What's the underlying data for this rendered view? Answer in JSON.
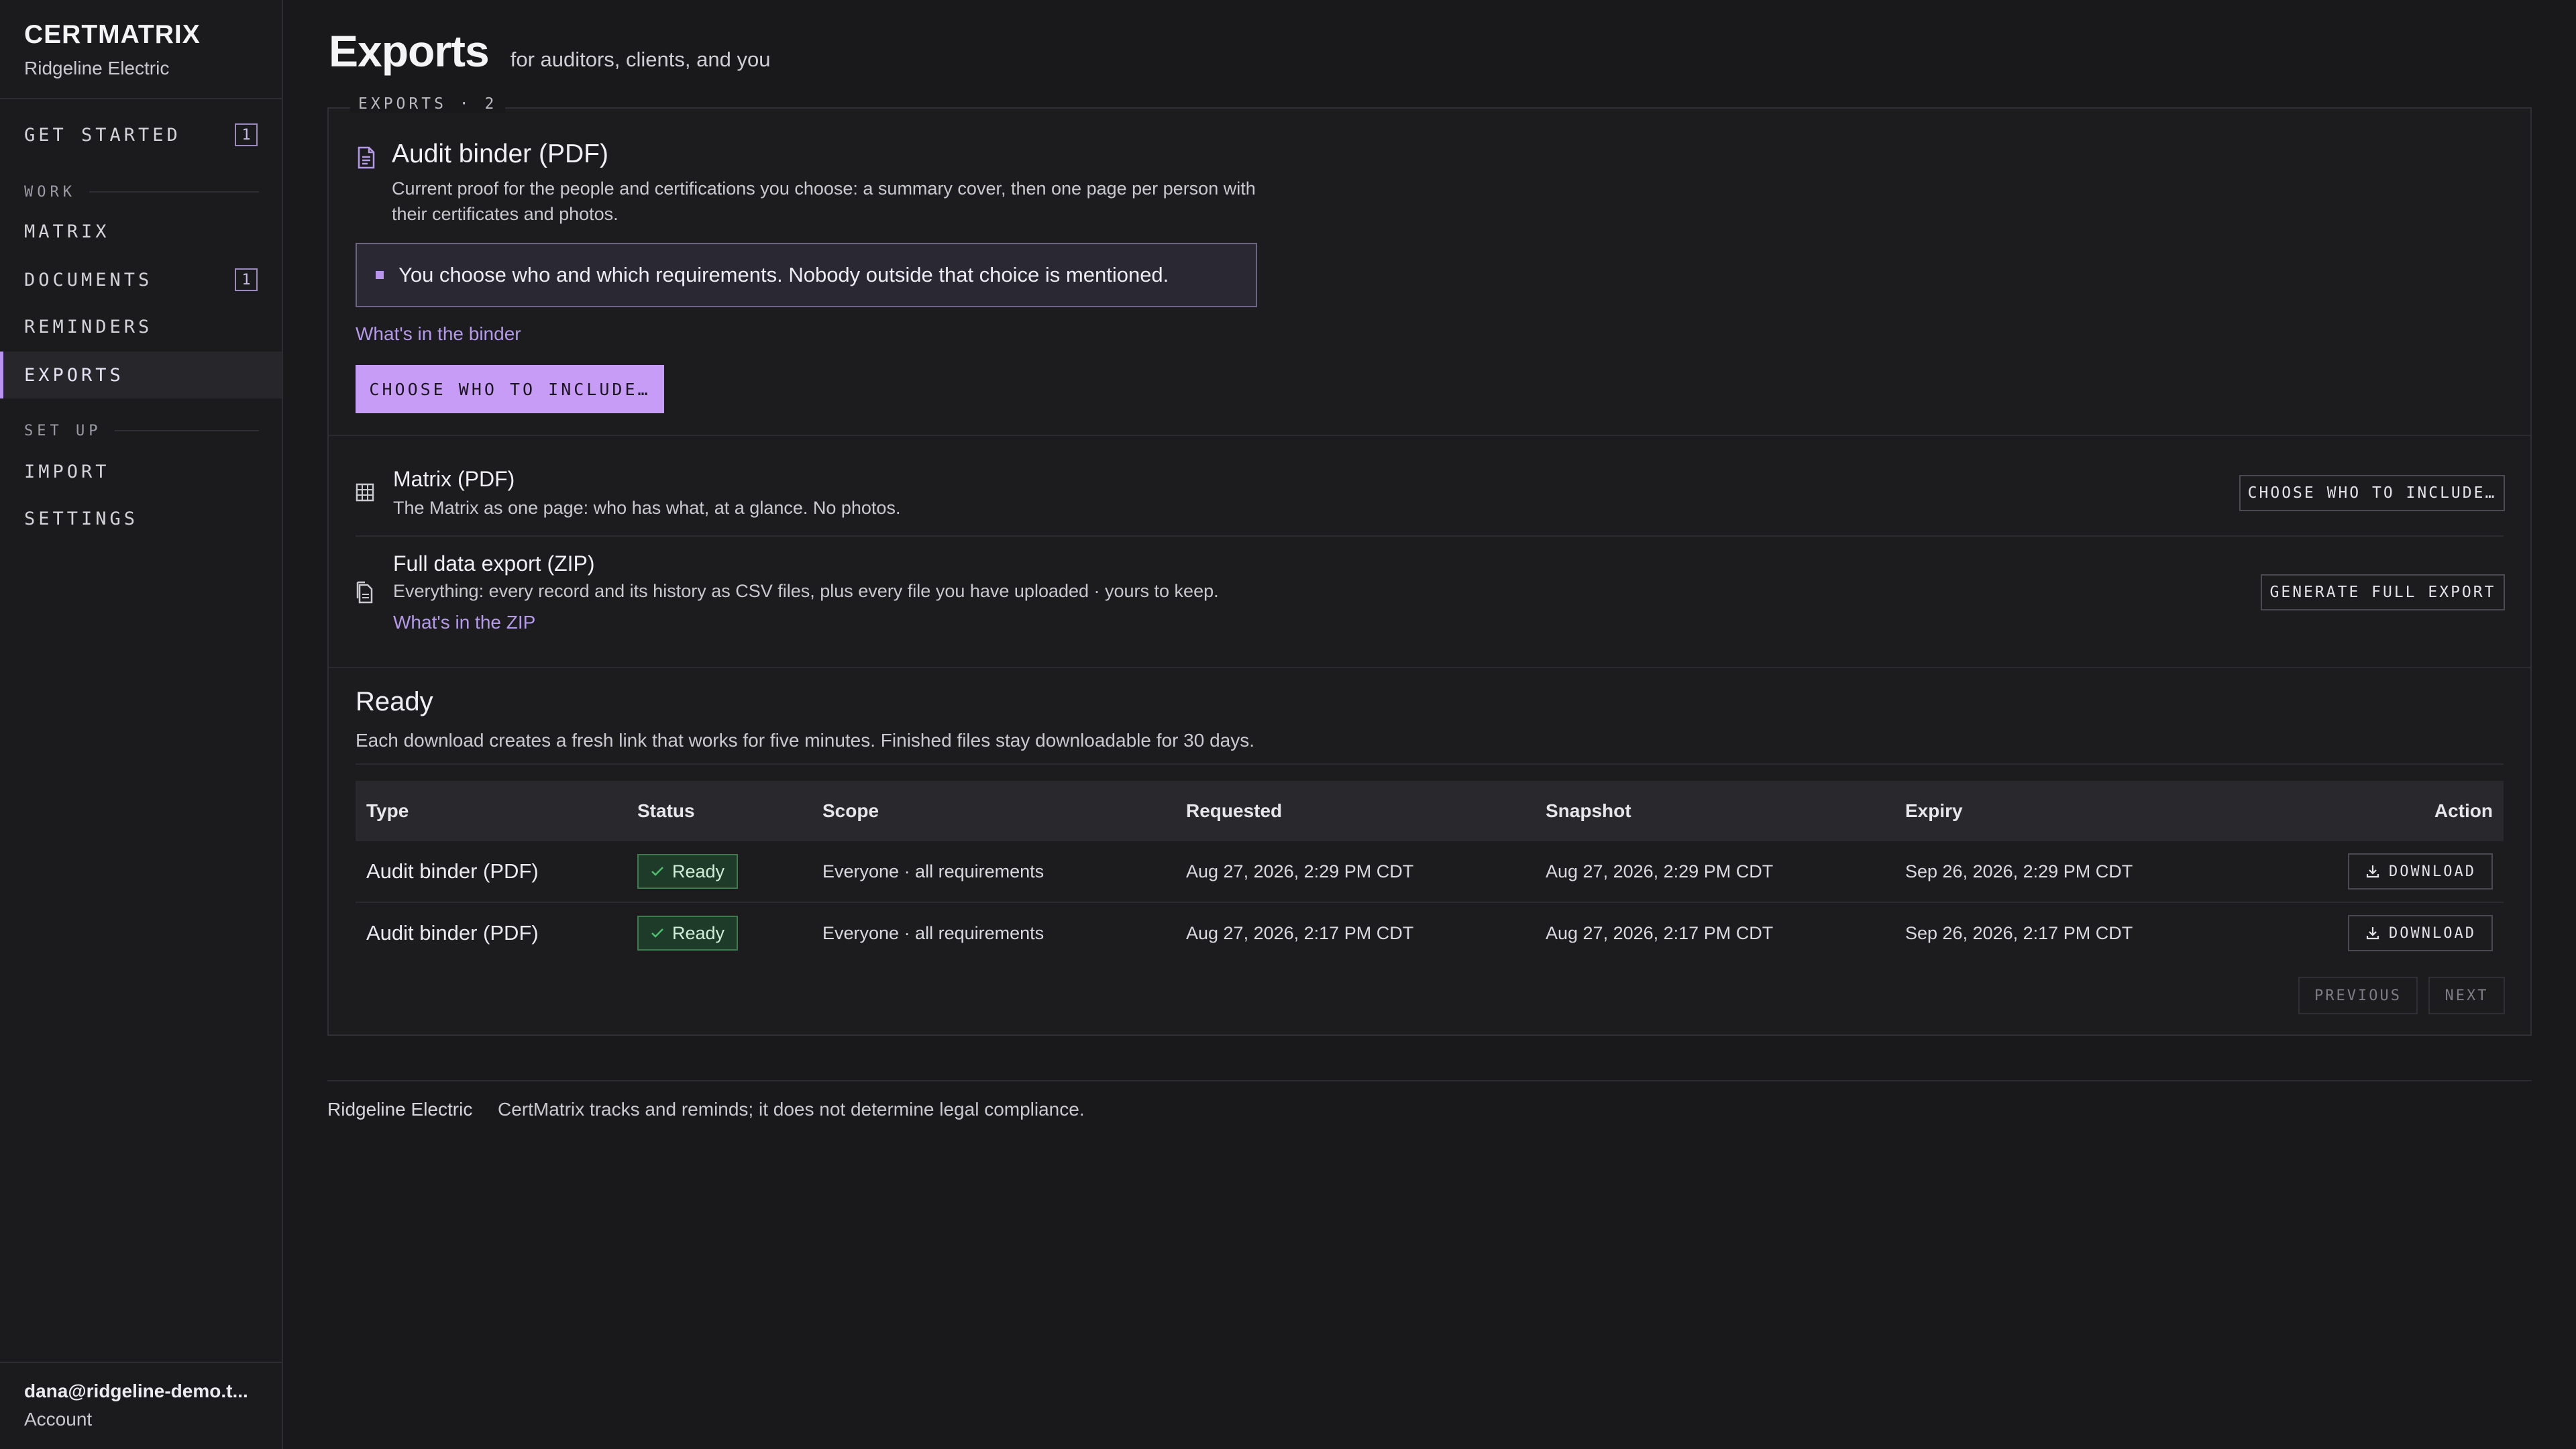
{
  "brand": {
    "name": "CERTMATRIX",
    "org": "Ridgeline Electric"
  },
  "nav": {
    "get_started": {
      "label": "GET STARTED",
      "badge": "1"
    },
    "section_work": "WORK",
    "matrix": "MATRIX",
    "documents": {
      "label": "DOCUMENTS",
      "badge": "1"
    },
    "reminders": "REMINDERS",
    "exports": "EXPORTS",
    "section_setup": "SET UP",
    "import": "IMPORT",
    "settings": "SETTINGS"
  },
  "account": {
    "email": "dana@ridgeline-demo.t...",
    "link": "Account"
  },
  "page": {
    "title": "Exports",
    "subtitle": "for auditors, clients, and you"
  },
  "panel": {
    "legend": "EXPORTS · 2",
    "audit": {
      "title": "Audit binder (PDF)",
      "desc": "Current proof for the people and certifications you choose: a summary cover, then one page per person with their certificates and photos.",
      "callout": "You choose who and which requirements. Nobody outside that choice is mentioned.",
      "link": "What's in the binder",
      "button": "CHOOSE WHO TO INCLUDE…"
    },
    "matrix": {
      "title": "Matrix (PDF)",
      "desc": "The Matrix as one page: who has what, at a glance. No photos.",
      "button": "CHOOSE WHO TO INCLUDE…"
    },
    "zip": {
      "title": "Full data export (ZIP)",
      "desc": "Everything: every record and its history as CSV files, plus every file you have uploaded · yours to keep.",
      "link": "What's in the ZIP",
      "button": "GENERATE FULL EXPORT"
    }
  },
  "ready": {
    "title": "Ready",
    "desc": "Each download creates a fresh link that works for five minutes. Finished files stay downloadable for 30 days.",
    "columns": [
      "Type",
      "Status",
      "Scope",
      "Requested",
      "Snapshot",
      "Expiry",
      "Action"
    ],
    "rows": [
      {
        "type": "Audit binder (PDF)",
        "status": "Ready",
        "scope": "Everyone · all requirements",
        "requested": "Aug 27, 2026, 2:29 PM CDT",
        "snapshot": "Aug 27, 2026, 2:29 PM CDT",
        "expiry": "Sep 26, 2026, 2:29 PM CDT",
        "action": "DOWNLOAD"
      },
      {
        "type": "Audit binder (PDF)",
        "status": "Ready",
        "scope": "Everyone · all requirements",
        "requested": "Aug 27, 2026, 2:17 PM CDT",
        "snapshot": "Aug 27, 2026, 2:17 PM CDT",
        "expiry": "Sep 26, 2026, 2:17 PM CDT",
        "action": "DOWNLOAD"
      }
    ],
    "pager": {
      "previous": "PREVIOUS",
      "next": "NEXT"
    }
  },
  "footer": {
    "org": "Ridgeline Electric",
    "note": "CertMatrix tracks and reminds; it does not determine legal compliance."
  },
  "colors": {
    "accent": "#c79cf7",
    "status_ready": "#1d3b28",
    "background": "#19191c"
  }
}
